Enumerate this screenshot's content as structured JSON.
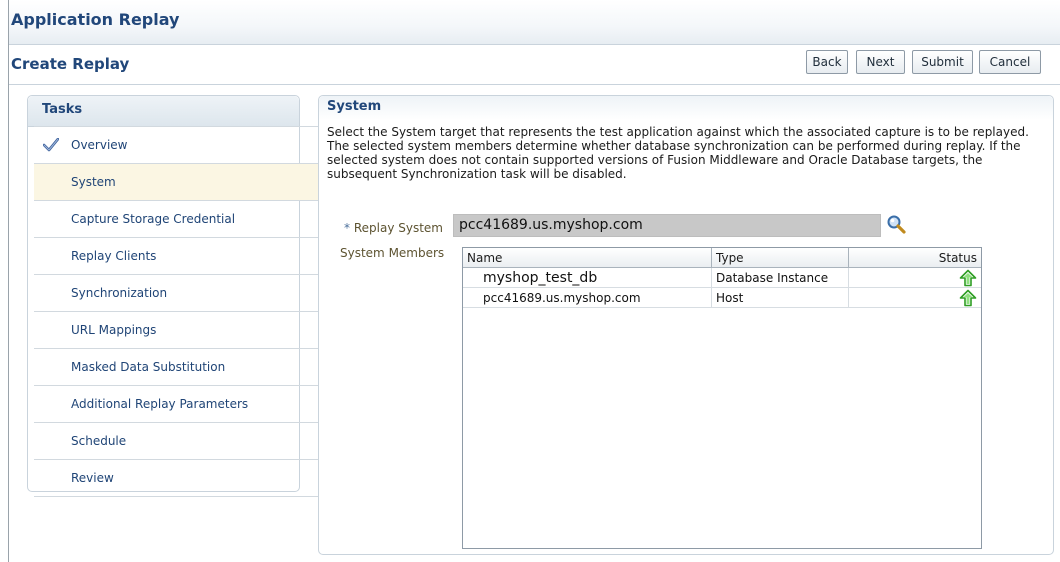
{
  "app": {
    "title": "Application Replay"
  },
  "page": {
    "title": "Create Replay"
  },
  "buttons": {
    "back": "Back",
    "next": "Next",
    "submit": "Submit",
    "cancel": "Cancel"
  },
  "tasks": {
    "title": "Tasks",
    "items": [
      {
        "label": "Overview",
        "completed": true
      },
      {
        "label": "System",
        "selected": true
      },
      {
        "label": "Capture Storage Credential"
      },
      {
        "label": "Replay Clients"
      },
      {
        "label": "Synchronization"
      },
      {
        "label": "URL Mappings"
      },
      {
        "label": "Masked Data Substitution"
      },
      {
        "label": "Additional Replay Parameters"
      },
      {
        "label": "Schedule"
      },
      {
        "label": "Review"
      }
    ]
  },
  "system": {
    "title": "System",
    "description": "Select the System target that represents the test application against which the associated capture is to be replayed. The selected system members determine whether database synchronization can be performed during replay. If the selected system does not contain supported versions of Fusion Middleware and Oracle Database targets, the subsequent Synchronization task will be disabled.",
    "replay_system_required": "*",
    "replay_system_label": "Replay System",
    "replay_system_value": "pcc41689.us.myshop.com",
    "members_label": "System Members",
    "columns": {
      "name": "Name",
      "type": "Type",
      "status": "Status"
    },
    "members": [
      {
        "name": "myshop_test_db",
        "type": "Database Instance",
        "status": "up-arrow-icon"
      },
      {
        "name": "pcc41689.us.myshop.com",
        "type": "Host",
        "status": "up-arrow-icon"
      }
    ]
  },
  "colors": {
    "title_blue": "#21477a",
    "link_blue": "#1f4476",
    "selected_row": "#fbf6e3",
    "status_up": "#3fbf2f"
  }
}
